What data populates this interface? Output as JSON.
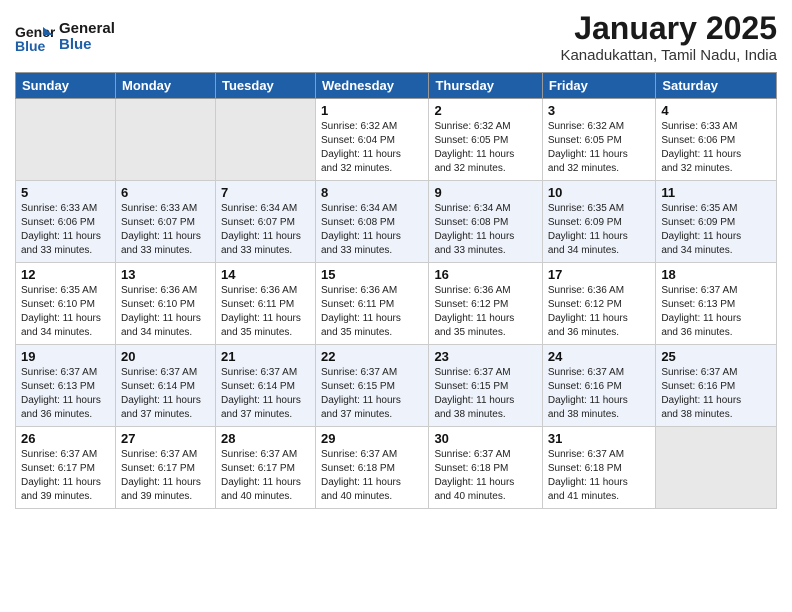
{
  "header": {
    "logo_general": "General",
    "logo_blue": "Blue",
    "month_title": "January 2025",
    "location": "Kanadukattan, Tamil Nadu, India"
  },
  "days_of_week": [
    "Sunday",
    "Monday",
    "Tuesday",
    "Wednesday",
    "Thursday",
    "Friday",
    "Saturday"
  ],
  "weeks": [
    [
      {
        "day": "",
        "info": ""
      },
      {
        "day": "",
        "info": ""
      },
      {
        "day": "",
        "info": ""
      },
      {
        "day": "1",
        "info": "Sunrise: 6:32 AM\nSunset: 6:04 PM\nDaylight: 11 hours\nand 32 minutes."
      },
      {
        "day": "2",
        "info": "Sunrise: 6:32 AM\nSunset: 6:05 PM\nDaylight: 11 hours\nand 32 minutes."
      },
      {
        "day": "3",
        "info": "Sunrise: 6:32 AM\nSunset: 6:05 PM\nDaylight: 11 hours\nand 32 minutes."
      },
      {
        "day": "4",
        "info": "Sunrise: 6:33 AM\nSunset: 6:06 PM\nDaylight: 11 hours\nand 32 minutes."
      }
    ],
    [
      {
        "day": "5",
        "info": "Sunrise: 6:33 AM\nSunset: 6:06 PM\nDaylight: 11 hours\nand 33 minutes."
      },
      {
        "day": "6",
        "info": "Sunrise: 6:33 AM\nSunset: 6:07 PM\nDaylight: 11 hours\nand 33 minutes."
      },
      {
        "day": "7",
        "info": "Sunrise: 6:34 AM\nSunset: 6:07 PM\nDaylight: 11 hours\nand 33 minutes."
      },
      {
        "day": "8",
        "info": "Sunrise: 6:34 AM\nSunset: 6:08 PM\nDaylight: 11 hours\nand 33 minutes."
      },
      {
        "day": "9",
        "info": "Sunrise: 6:34 AM\nSunset: 6:08 PM\nDaylight: 11 hours\nand 33 minutes."
      },
      {
        "day": "10",
        "info": "Sunrise: 6:35 AM\nSunset: 6:09 PM\nDaylight: 11 hours\nand 34 minutes."
      },
      {
        "day": "11",
        "info": "Sunrise: 6:35 AM\nSunset: 6:09 PM\nDaylight: 11 hours\nand 34 minutes."
      }
    ],
    [
      {
        "day": "12",
        "info": "Sunrise: 6:35 AM\nSunset: 6:10 PM\nDaylight: 11 hours\nand 34 minutes."
      },
      {
        "day": "13",
        "info": "Sunrise: 6:36 AM\nSunset: 6:10 PM\nDaylight: 11 hours\nand 34 minutes."
      },
      {
        "day": "14",
        "info": "Sunrise: 6:36 AM\nSunset: 6:11 PM\nDaylight: 11 hours\nand 35 minutes."
      },
      {
        "day": "15",
        "info": "Sunrise: 6:36 AM\nSunset: 6:11 PM\nDaylight: 11 hours\nand 35 minutes."
      },
      {
        "day": "16",
        "info": "Sunrise: 6:36 AM\nSunset: 6:12 PM\nDaylight: 11 hours\nand 35 minutes."
      },
      {
        "day": "17",
        "info": "Sunrise: 6:36 AM\nSunset: 6:12 PM\nDaylight: 11 hours\nand 36 minutes."
      },
      {
        "day": "18",
        "info": "Sunrise: 6:37 AM\nSunset: 6:13 PM\nDaylight: 11 hours\nand 36 minutes."
      }
    ],
    [
      {
        "day": "19",
        "info": "Sunrise: 6:37 AM\nSunset: 6:13 PM\nDaylight: 11 hours\nand 36 minutes."
      },
      {
        "day": "20",
        "info": "Sunrise: 6:37 AM\nSunset: 6:14 PM\nDaylight: 11 hours\nand 37 minutes."
      },
      {
        "day": "21",
        "info": "Sunrise: 6:37 AM\nSunset: 6:14 PM\nDaylight: 11 hours\nand 37 minutes."
      },
      {
        "day": "22",
        "info": "Sunrise: 6:37 AM\nSunset: 6:15 PM\nDaylight: 11 hours\nand 37 minutes."
      },
      {
        "day": "23",
        "info": "Sunrise: 6:37 AM\nSunset: 6:15 PM\nDaylight: 11 hours\nand 38 minutes."
      },
      {
        "day": "24",
        "info": "Sunrise: 6:37 AM\nSunset: 6:16 PM\nDaylight: 11 hours\nand 38 minutes."
      },
      {
        "day": "25",
        "info": "Sunrise: 6:37 AM\nSunset: 6:16 PM\nDaylight: 11 hours\nand 38 minutes."
      }
    ],
    [
      {
        "day": "26",
        "info": "Sunrise: 6:37 AM\nSunset: 6:17 PM\nDaylight: 11 hours\nand 39 minutes."
      },
      {
        "day": "27",
        "info": "Sunrise: 6:37 AM\nSunset: 6:17 PM\nDaylight: 11 hours\nand 39 minutes."
      },
      {
        "day": "28",
        "info": "Sunrise: 6:37 AM\nSunset: 6:17 PM\nDaylight: 11 hours\nand 40 minutes."
      },
      {
        "day": "29",
        "info": "Sunrise: 6:37 AM\nSunset: 6:18 PM\nDaylight: 11 hours\nand 40 minutes."
      },
      {
        "day": "30",
        "info": "Sunrise: 6:37 AM\nSunset: 6:18 PM\nDaylight: 11 hours\nand 40 minutes."
      },
      {
        "day": "31",
        "info": "Sunrise: 6:37 AM\nSunset: 6:18 PM\nDaylight: 11 hours\nand 41 minutes."
      },
      {
        "day": "",
        "info": ""
      }
    ]
  ]
}
